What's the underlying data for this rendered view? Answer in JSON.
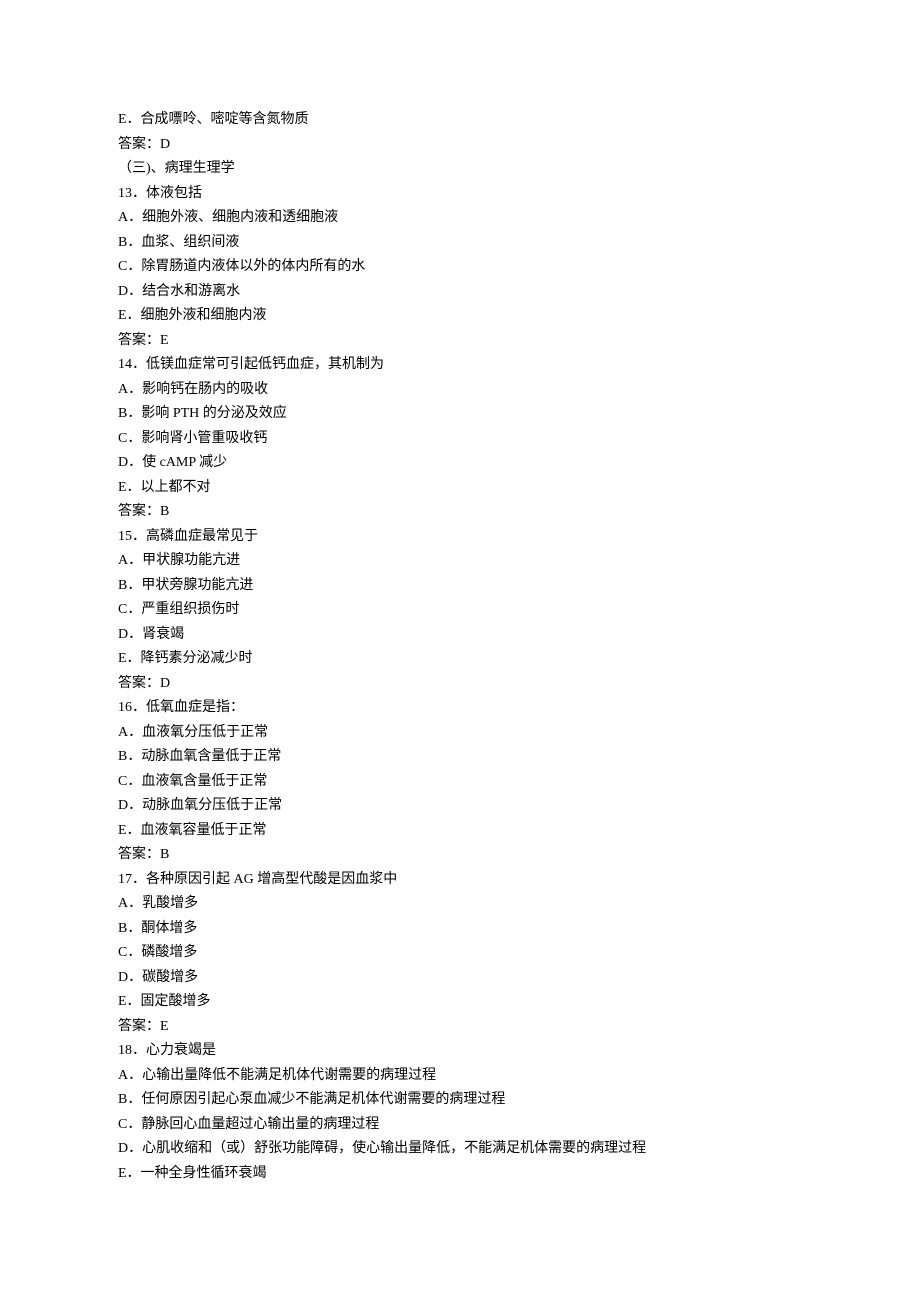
{
  "lines": [
    "E．合成嘌呤、嘧啶等含氮物质",
    "答案：D",
    "（三)、病理生理学",
    "13．体液包括",
    "A．细胞外液、细胞内液和透细胞液",
    "B．血浆、组织间液",
    "C．除胃肠道内液体以外的体内所有的水",
    "D．结合水和游离水",
    "E．细胞外液和细胞内液",
    "答案：E",
    "14．低镁血症常可引起低钙血症，其机制为",
    "A．影响钙在肠内的吸收",
    "B．影响 PTH 的分泌及效应",
    "C．影响肾小管重吸收钙",
    "D．使 cAMP 减少",
    "E．以上都不对",
    "答案：B",
    "15．高磷血症最常见于",
    "A．甲状腺功能亢进",
    "B．甲状旁腺功能亢进",
    "C．严重组织损伤时",
    "D．肾衰竭",
    "E．降钙素分泌减少时",
    "答案：D",
    "16．低氧血症是指：",
    "A．血液氧分压低于正常",
    "B．动脉血氧含量低于正常",
    "C．血液氧含量低于正常",
    "D．动脉血氧分压低于正常",
    "E．血液氧容量低于正常",
    "答案：B",
    "17．各种原因引起 AG 增高型代酸是因血浆中",
    "A．乳酸增多",
    "B．酮体增多",
    "C．磷酸增多",
    "D．碳酸增多",
    "E．固定酸增多",
    "答案：E",
    "18．心力衰竭是",
    "A．心输出量降低不能满足机体代谢需要的病理过程",
    "B．任何原因引起心泵血减少不能满足机体代谢需要的病理过程",
    "C．静脉回心血量超过心输出量的病理过程",
    "D．心肌收缩和（或）舒张功能障碍，使心输出量降低，不能满足机体需要的病理过程",
    "E．一种全身性循环衰竭"
  ]
}
